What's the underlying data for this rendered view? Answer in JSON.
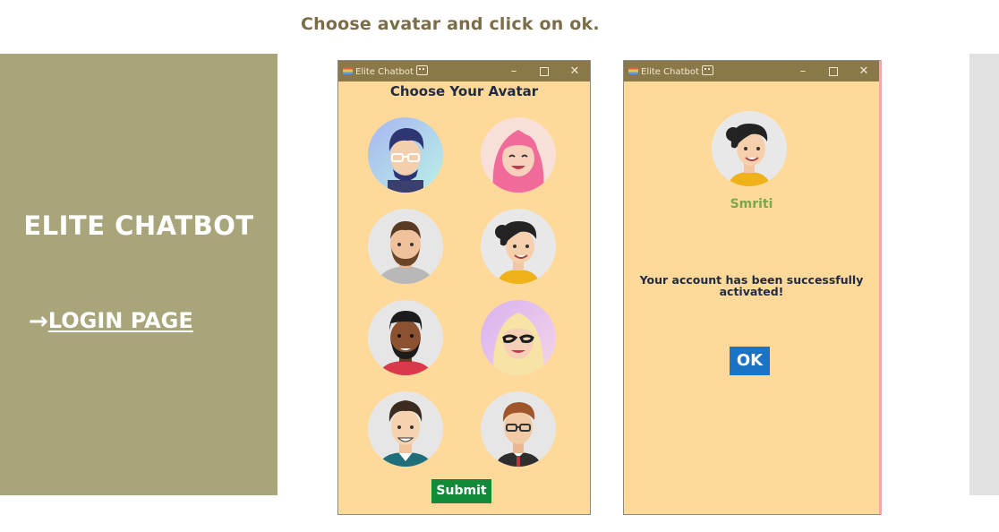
{
  "instruction": "Choose avatar and click on ok.",
  "side_panel": {
    "brand": "ELITE CHATBOT",
    "link_arrow": "→",
    "link_label": "LOGIN PAGE"
  },
  "window_title": "Elite Chatbot",
  "window_controls": {
    "minimize": "–",
    "close": "✕"
  },
  "avatar_window": {
    "heading": "Choose Your Avatar",
    "avatars": [
      "avatar-1",
      "avatar-2",
      "avatar-3",
      "avatar-4",
      "avatar-5",
      "avatar-6",
      "avatar-7",
      "avatar-8"
    ],
    "submit_label": "Submit"
  },
  "confirm_window": {
    "name": "Smriti",
    "message_line1": "Your account has been successfully",
    "message_line2": "activated!",
    "ok_label": "OK"
  },
  "colors": {
    "window_bg": "#ffd99a",
    "titlebar": "#8a7848",
    "side_panel": "#a9a57b",
    "submit": "#138a3a",
    "ok": "#1a73c4",
    "name": "#7aa84c"
  }
}
